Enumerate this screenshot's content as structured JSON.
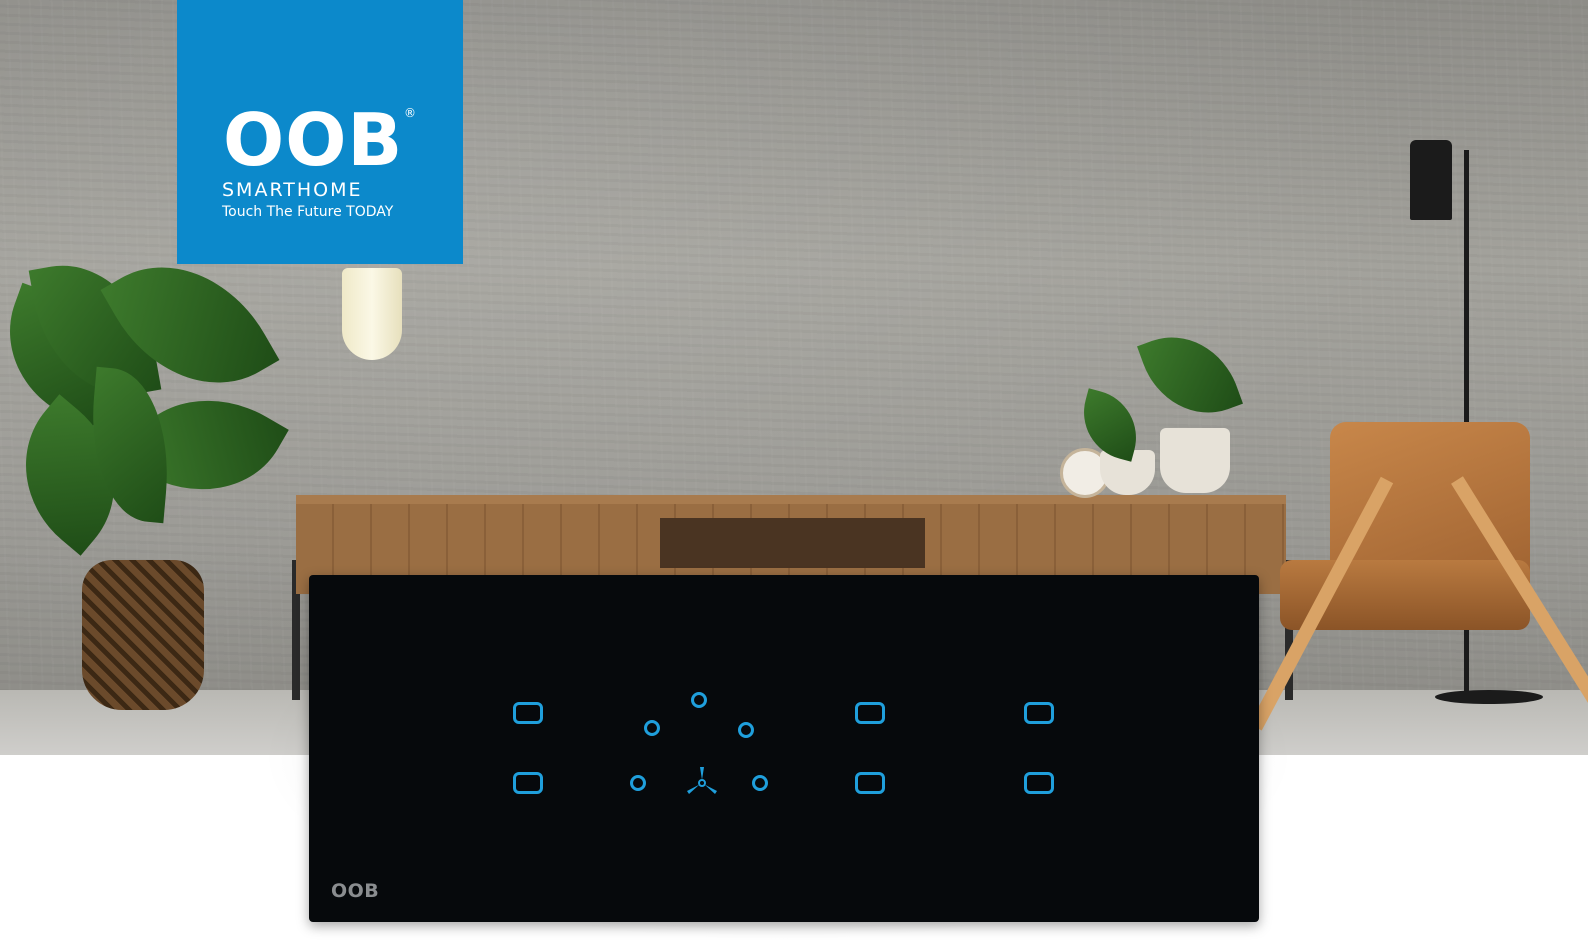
{
  "brand": {
    "logo": "OOB",
    "registered": "®",
    "subtitle": "SMARTHOME",
    "tagline": "Touch The Future TODAY",
    "color": "#0c89cb"
  },
  "panel": {
    "brand": "OOB",
    "accent": "#1f9fdc",
    "background": "#06090c",
    "icons": [
      "switch-key-icon",
      "fan-speed-dot-icon",
      "fan-icon"
    ]
  }
}
